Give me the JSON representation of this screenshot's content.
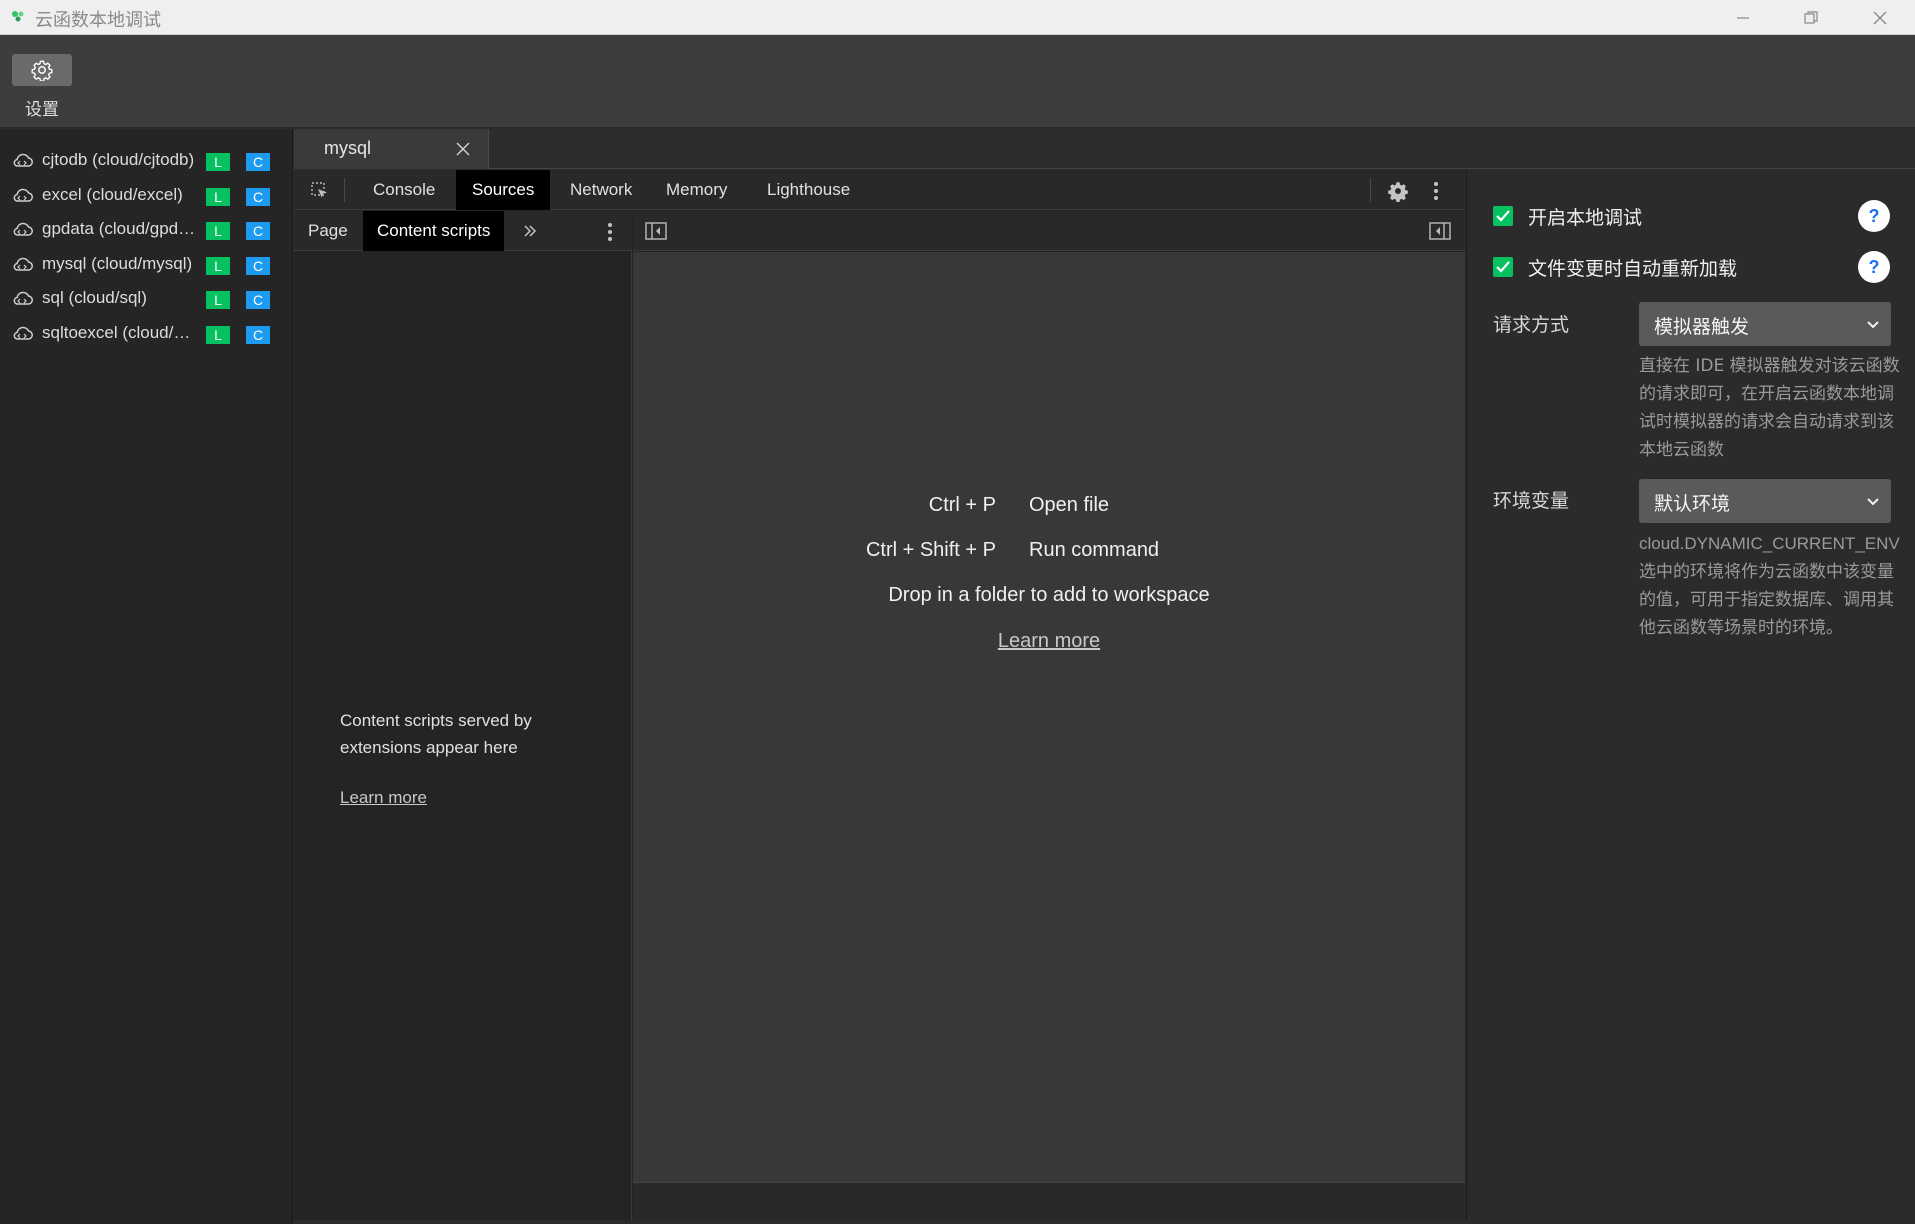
{
  "window": {
    "title": "云函数本地调试"
  },
  "toolbar": {
    "settings_label": "设置"
  },
  "sidebar": {
    "items": [
      {
        "name": "cjtodb (cloud/cjtodb)",
        "badge_l": "L",
        "badge_c": "C"
      },
      {
        "name": "excel (cloud/excel)",
        "badge_l": "L",
        "badge_c": "C"
      },
      {
        "name": "gpdata (cloud/gpdata)",
        "badge_l": "L",
        "badge_c": "C"
      },
      {
        "name": "mysql (cloud/mysql)",
        "badge_l": "L",
        "badge_c": "C"
      },
      {
        "name": "sql (cloud/sql)",
        "badge_l": "L",
        "badge_c": "C"
      },
      {
        "name": "sqltoexcel (cloud/sqltoexcel)",
        "badge_l": "L",
        "badge_c": "C"
      }
    ]
  },
  "doc_tab": {
    "label": "mysql"
  },
  "devtools": {
    "tabs": [
      "Console",
      "Sources",
      "Network",
      "Memory",
      "Lighthouse"
    ],
    "active_tab": "Sources",
    "sub_tabs": [
      "Page",
      "Content scripts"
    ],
    "active_sub_tab": "Content scripts",
    "nav_message": "Content scripts served by extensions appear here",
    "nav_learn_more": "Learn more",
    "editor": {
      "shortcut_1_key": "Ctrl + P",
      "shortcut_1_action": "Open file",
      "shortcut_2_key": "Ctrl + Shift + P",
      "shortcut_2_action": "Run command",
      "drop_text": "Drop in a folder to add to workspace",
      "learn_more": "Learn more"
    }
  },
  "right_panel": {
    "enable_local_debug": "开启本地调试",
    "enable_local_debug_checked": true,
    "auto_reload": "文件变更时自动重新加载",
    "auto_reload_checked": true,
    "request_method_label": "请求方式",
    "request_method_value": "模拟器触发",
    "request_method_desc": "直接在 IDE 模拟器触发对该云函数的请求即可，在开启云函数本地调试时模拟器的请求会自动请求到该本地云函数",
    "env_label": "环境变量",
    "env_value": "默认环境",
    "env_desc_code": "cloud.DYNAMIC_CURRENT_ENV",
    "env_desc": "选中的环境将作为云函数中该变量的值，可用于指定数据库、调用其他云函数等场景时的环境。"
  },
  "colors": {
    "badge_l": "#07c160",
    "badge_c": "#1d9bf0",
    "checkbox": "#07c160",
    "help_icon": "#1d6ff2"
  }
}
